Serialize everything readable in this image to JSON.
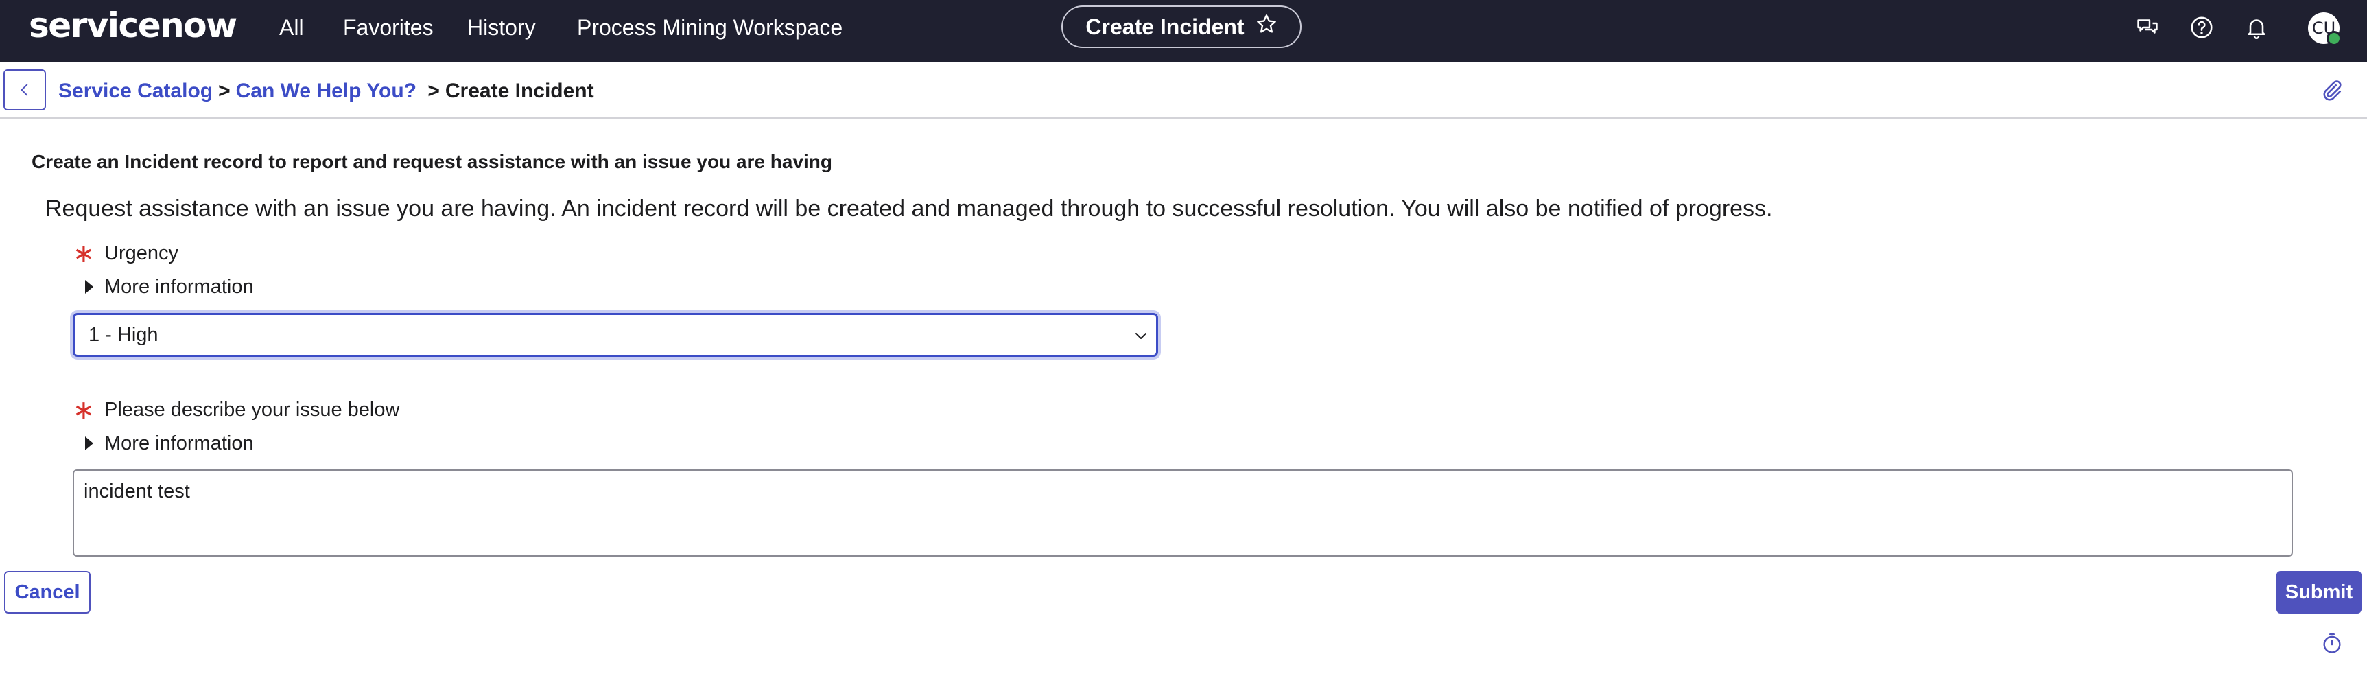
{
  "header": {
    "logo_text": "servicenow",
    "nav": [
      "All",
      "Favorites",
      "History",
      "Process Mining Workspace"
    ],
    "context_pill": "Create Incident",
    "icons": [
      "chat-icon",
      "help-icon",
      "bell-icon"
    ],
    "avatar_initials": "CU",
    "colors": {
      "bar": "#1f2030",
      "presence": "#3fae5a"
    }
  },
  "breadcrumb": {
    "items": [
      "Service Catalog",
      "Can We Help You?"
    ],
    "separator": ">",
    "current": "Create Incident"
  },
  "form": {
    "heading": "Create an Incident record to report and request assistance with an issue you are having",
    "description": "Request assistance with an issue you are having. An incident record will be created and managed through to successful resolution. You will also be notified of progress.",
    "required_marker": "∗",
    "urgency": {
      "label": "Urgency",
      "more_info": "More information",
      "value": "1 - High"
    },
    "issue": {
      "label": "Please describe your issue below",
      "more_info": "More information",
      "value": "incident test"
    }
  },
  "actions": {
    "cancel": "Cancel",
    "submit": "Submit"
  },
  "colors": {
    "accent": "#4f52bd",
    "link": "#3c4cc6",
    "required": "#d6312b"
  }
}
